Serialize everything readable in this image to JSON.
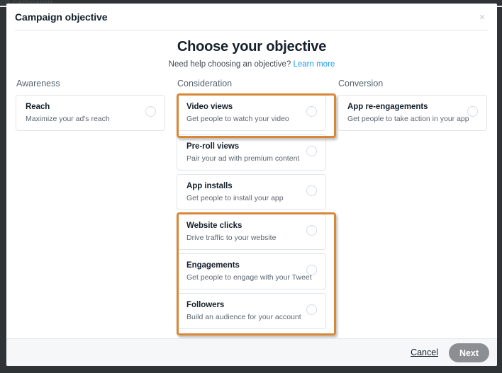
{
  "background": {
    "obscured_text": "ch campaign",
    "page_color": "#2f3336"
  },
  "modal": {
    "title": "Campaign objective",
    "close_icon": "close-icon",
    "close_label": "×",
    "headline": "Choose your objective",
    "subhead_text": "Need help choosing an objective?",
    "subhead_link": "Learn more",
    "link_color": "#1d9bf0"
  },
  "columns": [
    {
      "heading": "Awareness",
      "cards": [
        {
          "title": "Reach",
          "description": "Maximize your ad's reach",
          "selected": false
        }
      ]
    },
    {
      "heading": "Consideration",
      "cards": [
        {
          "title": "Video views",
          "description": "Get people to watch your video",
          "selected": false
        },
        {
          "title": "Pre-roll views",
          "description": "Pair your ad with premium content",
          "selected": false
        },
        {
          "title": "App installs",
          "description": "Get people to install your app",
          "selected": false
        },
        {
          "title": "Website clicks",
          "description": "Drive traffic to your website",
          "selected": false
        },
        {
          "title": "Engagements",
          "description": "Get people to engage with your Tweet",
          "selected": false
        },
        {
          "title": "Followers",
          "description": "Build an audience for your account",
          "selected": false
        }
      ]
    },
    {
      "heading": "Conversion",
      "cards": [
        {
          "title": "App re-engagements",
          "description": "Get people to take action in your app",
          "selected": false
        }
      ]
    }
  ],
  "highlights": {
    "color": "#d98736",
    "regions": [
      {
        "name": "video-views",
        "label": "Video views"
      },
      {
        "name": "lower-group",
        "label": "Website clicks, Engagements, Followers"
      }
    ]
  },
  "footer": {
    "cancel_label": "Cancel",
    "next_label": "Next",
    "next_enabled": false,
    "next_color": "#8b8f93"
  }
}
